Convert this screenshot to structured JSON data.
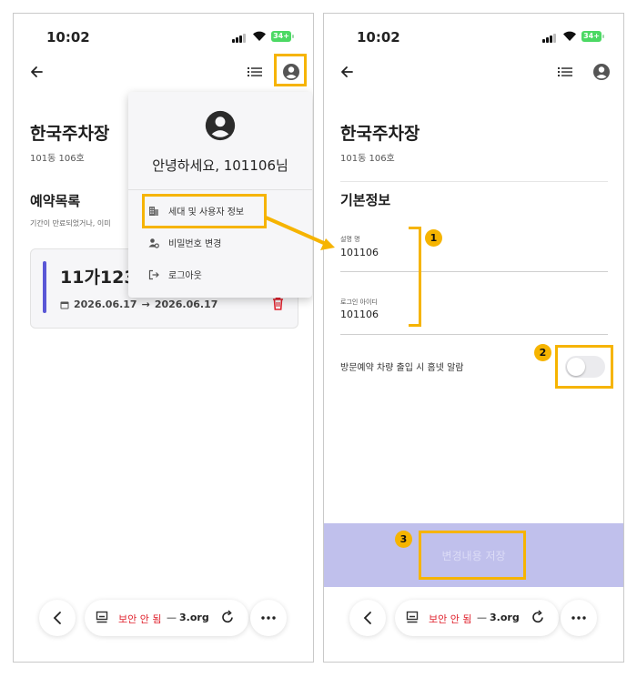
{
  "status": {
    "time": "10:02",
    "battery": "34+"
  },
  "left": {
    "parking_name": "한국주차장",
    "unit": "101동 106호",
    "section_title": "예약목록",
    "section_note": "기간이 만료되었거나, 이미",
    "reservation": {
      "plate": "11가1234",
      "date_from": "2026.06.17",
      "arrow": "→",
      "date_to": "2026.06.17"
    },
    "menu": {
      "greeting": "안녕하세요, 101106님",
      "items": [
        {
          "label": "세대 및 사용자 정보",
          "icon": "building-icon"
        },
        {
          "label": "비밀번호 변경",
          "icon": "user-gear-icon"
        },
        {
          "label": "로그아웃",
          "icon": "logout-icon"
        }
      ]
    }
  },
  "right": {
    "parking_name": "한국주차장",
    "unit": "101동 106호",
    "section_title": "기본정보",
    "fields": [
      {
        "label": "설명 명",
        "value": "101106"
      },
      {
        "label": "로그인 아이디",
        "value": "101106"
      }
    ],
    "alarm_toggle": {
      "label": "방문예약 차량 출입 시 홈넷 알람",
      "on": false
    },
    "save_label": "변경내용 저장"
  },
  "annotations": {
    "n1": "1",
    "n2": "2",
    "n3": "3",
    "color": "#f6b400"
  },
  "browser": {
    "insecure_label": "보안 안 됨",
    "dash": "—",
    "domain_fade": "",
    "domain": "3.org"
  },
  "colors": {
    "accent": "#5a57d6",
    "save_bar": "#c0c0ec",
    "danger": "#e0242f",
    "highlight": "#f6b400"
  }
}
